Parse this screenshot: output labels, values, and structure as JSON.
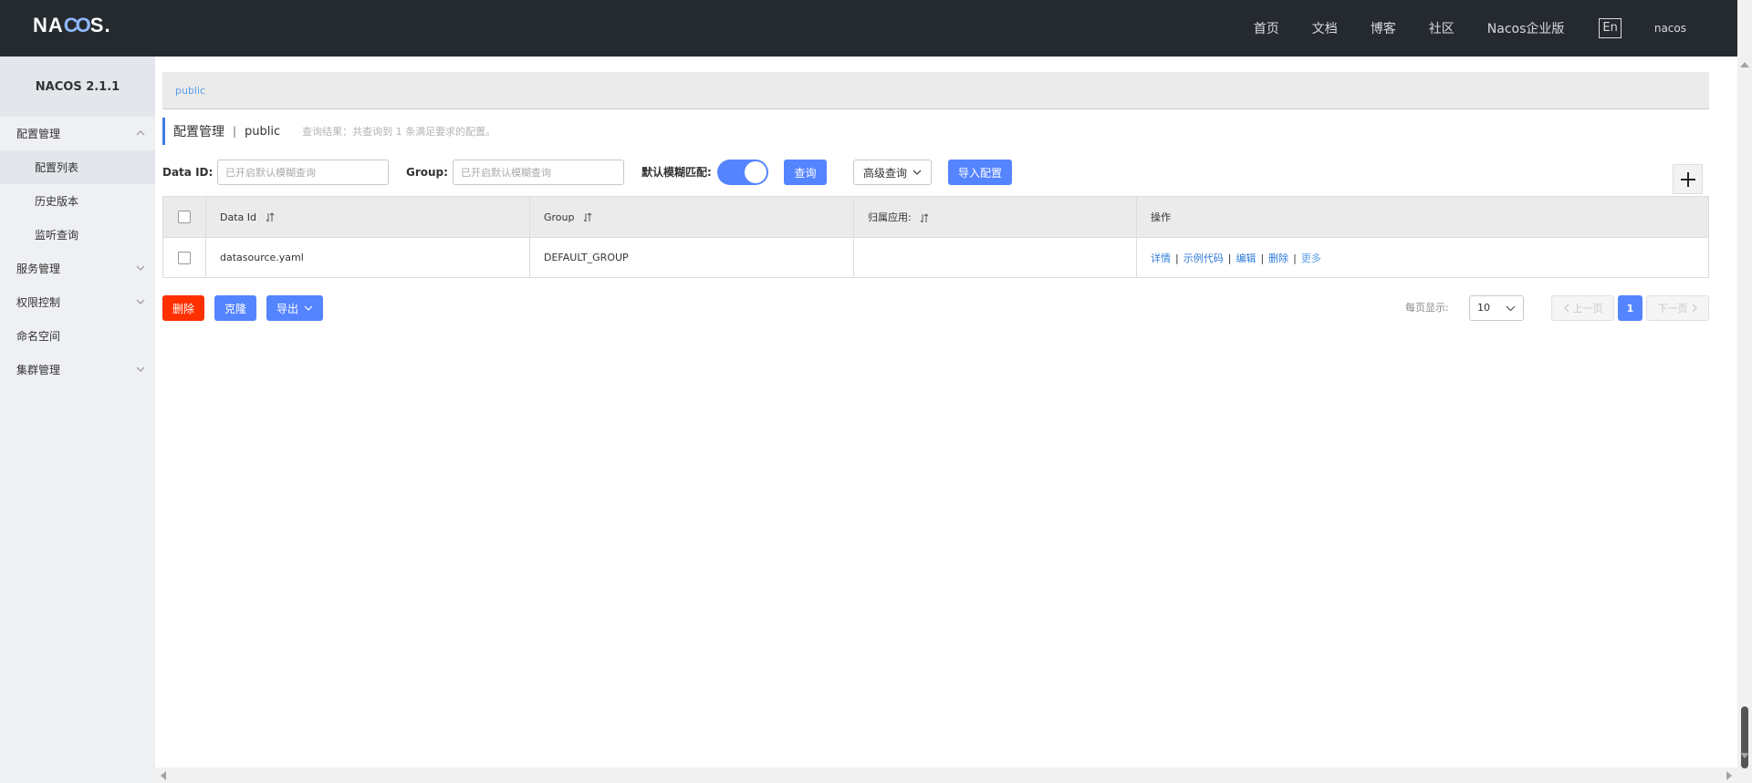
{
  "header": {
    "logo": {
      "prefix": "NA",
      "middle": "CO",
      "suffix": "S."
    },
    "nav": [
      "首页",
      "文档",
      "博客",
      "社区",
      "Nacos企业版"
    ],
    "lang": "En",
    "user": "nacos"
  },
  "sidebar": {
    "version": "NACOS 2.1.1",
    "items": [
      {
        "label": "配置管理",
        "icon": "chevron-up-icon"
      },
      {
        "label": "配置列表"
      },
      {
        "label": "历史版本"
      },
      {
        "label": "监听查询"
      },
      {
        "label": "服务管理",
        "icon": "chevron-down-icon"
      },
      {
        "label": "权限控制",
        "icon": "chevron-down-icon"
      },
      {
        "label": "命名空间"
      },
      {
        "label": "集群管理",
        "icon": "chevron-down-icon"
      }
    ]
  },
  "breadcrumb": "public",
  "title": {
    "main": "配置管理",
    "sep": "|",
    "namespace": "public",
    "hint": "查询结果：共查询到 1 条满足要求的配置。"
  },
  "filters": {
    "data_id_label": "Data ID:",
    "data_id_placeholder": "已开启默认模糊查询",
    "group_label": "Group:",
    "group_placeholder": "已开启默认模糊查询",
    "fuzzy_label": "默认模糊匹配:",
    "fuzzy_on": true,
    "search_button": "查询",
    "advanced_button": "高级查询",
    "import_button": "导入配置"
  },
  "table": {
    "headers": [
      "Data Id",
      "Group",
      "归属应用:",
      "操作"
    ],
    "rows": [
      {
        "data_id": "datasource.yaml",
        "group": "DEFAULT_GROUP",
        "app": ""
      }
    ],
    "actions": [
      "详情",
      "示例代码",
      "编辑",
      "删除",
      "更多"
    ],
    "action_sep": "|"
  },
  "bottom": {
    "delete_button": "删除",
    "clone_button": "克隆",
    "export_button": "导出",
    "page_size_label": "每页显示:",
    "page_size": "10",
    "prev": "上一页",
    "current_page": "1",
    "next": "下一页"
  },
  "colors": {
    "topbar": "#252a2f",
    "primary": "#5584ff",
    "danger": "#ff3000",
    "link": "#2f7bd9"
  }
}
